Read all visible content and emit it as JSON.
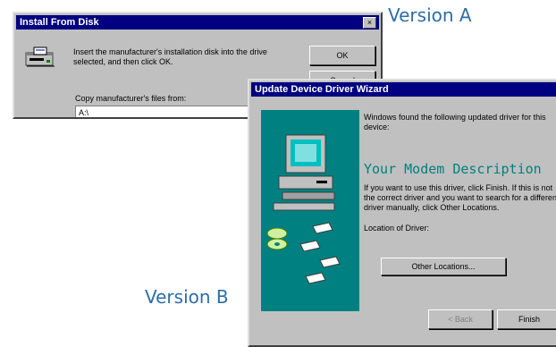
{
  "labels": {
    "version_a": "Version A",
    "version_b": "Version B"
  },
  "install_dialog": {
    "title": "Install From Disk",
    "close_glyph": "×",
    "message": "Insert the manufacturer's installation disk into the drive selected, and then click OK.",
    "ok_label": "OK",
    "cancel_label": "Cancel",
    "copy_label": "Copy manufacturer's files from:",
    "path_value": "A:\\",
    "icon": "floppy-drive-icon"
  },
  "wizard": {
    "title": "Update Device Driver Wizard",
    "intro_text": "Windows found the following updated driver for this device:",
    "device_description": "Your Modem Description",
    "help_text": "If you want to use this driver, click Finish. If this is not the correct driver and you want to search for a different driver manually, click Other Locations.",
    "location_label": "Location of Driver:",
    "other_locations_label": "Other Locations...",
    "back_label": "< Back",
    "finish_label": "Finish",
    "illustration": "computer-with-disks-illustration",
    "panel_color": "#008080"
  }
}
